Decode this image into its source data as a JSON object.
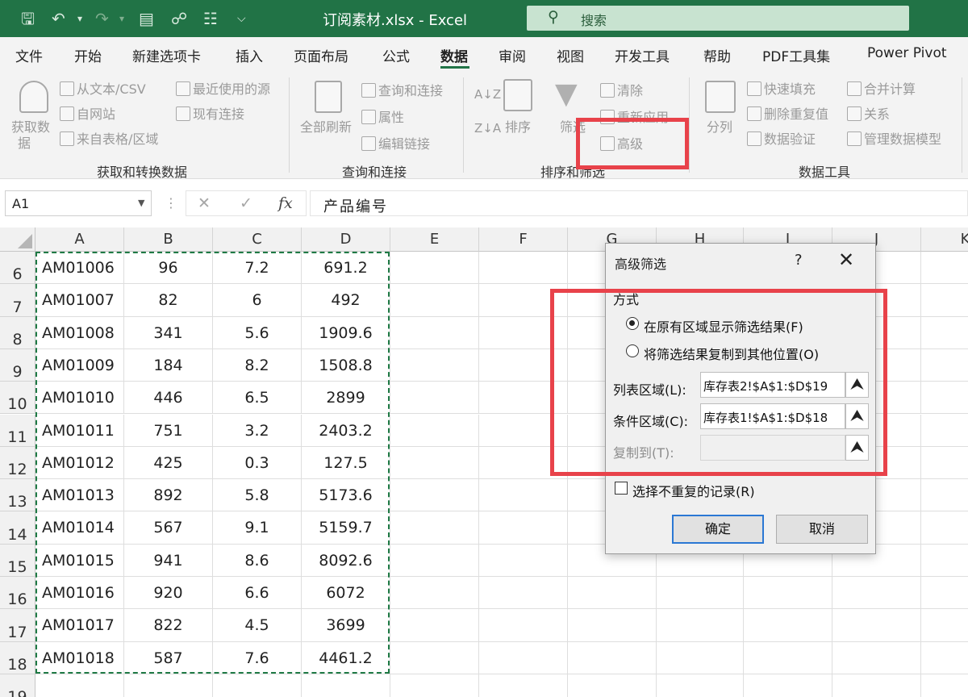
{
  "app": {
    "title": "订阅素材.xlsx  -  Excel",
    "search_placeholder": "搜索"
  },
  "quick_access": [
    "save-icon",
    "undo-icon",
    "redo-icon",
    "form-icon",
    "touch-icon",
    "print-preview-icon",
    "customize-icon"
  ],
  "tabs": [
    "文件",
    "开始",
    "新建选项卡",
    "插入",
    "页面布局",
    "公式",
    "数据",
    "审阅",
    "视图",
    "开发工具",
    "帮助",
    "PDF工具集",
    "Power Pivot"
  ],
  "active_tab": "数据",
  "ribbon": {
    "get_data": {
      "label_line1": "获取数",
      "label_line2": "据",
      "from_text": "从文本/CSV",
      "from_web": "自网站",
      "from_table": "来自表格/区域",
      "recent": "最近使用的源",
      "existing": "现有连接",
      "group": "获取和转换数据"
    },
    "queries": {
      "refresh_all": "全部刷新",
      "queries_conn": "查询和连接",
      "properties": "属性",
      "edit_links": "编辑链接",
      "group": "查询和连接"
    },
    "sort_filter": {
      "sort": "排序",
      "filter": "筛选",
      "clear": "清除",
      "reapply": "重新应用",
      "advanced": "高级",
      "group": "排序和筛选"
    },
    "data_tools": {
      "split": "分列",
      "flash_fill": "快速填充",
      "remove_dup": "删除重复值",
      "validation": "数据验证",
      "consolidate": "合并计算",
      "relations": "关系",
      "data_model": "管理数据模型",
      "group": "数据工具"
    },
    "highlight_color": "#e8424a"
  },
  "formula_bar": {
    "name_box": "A1",
    "cancel": "✕",
    "confirm": "✓",
    "fx": "fx",
    "formula": "产品编号"
  },
  "sheet": {
    "columns": [
      "A",
      "B",
      "C",
      "D",
      "E",
      "F",
      "G",
      "H",
      "I",
      "J",
      "K"
    ],
    "rows": [
      {
        "num": "6",
        "cells": [
          "AM01006",
          "96",
          "7.2",
          "691.2"
        ]
      },
      {
        "num": "7",
        "cells": [
          "AM01007",
          "82",
          "6",
          "492"
        ]
      },
      {
        "num": "8",
        "cells": [
          "AM01008",
          "341",
          "5.6",
          "1909.6"
        ]
      },
      {
        "num": "9",
        "cells": [
          "AM01009",
          "184",
          "8.2",
          "1508.8"
        ]
      },
      {
        "num": "10",
        "cells": [
          "AM01010",
          "446",
          "6.5",
          "2899"
        ]
      },
      {
        "num": "11",
        "cells": [
          "AM01011",
          "751",
          "3.2",
          "2403.2"
        ]
      },
      {
        "num": "12",
        "cells": [
          "AM01012",
          "425",
          "0.3",
          "127.5"
        ]
      },
      {
        "num": "13",
        "cells": [
          "AM01013",
          "892",
          "5.8",
          "5173.6"
        ]
      },
      {
        "num": "14",
        "cells": [
          "AM01014",
          "567",
          "9.1",
          "5159.7"
        ]
      },
      {
        "num": "15",
        "cells": [
          "AM01015",
          "941",
          "8.6",
          "8092.6"
        ]
      },
      {
        "num": "16",
        "cells": [
          "AM01016",
          "920",
          "6.6",
          "6072"
        ]
      },
      {
        "num": "17",
        "cells": [
          "AM01017",
          "822",
          "4.5",
          "3699"
        ]
      },
      {
        "num": "18",
        "cells": [
          "AM01018",
          "587",
          "7.6",
          "4461.2"
        ]
      },
      {
        "num": "19",
        "cells": [
          "",
          "",
          "",
          ""
        ]
      }
    ]
  },
  "dialog": {
    "title": "高级筛选",
    "help": "?",
    "close": "✕",
    "mode_label": "方式",
    "option_inplace": "在原有区域显示筛选结果(F)",
    "option_copy": "将筛选结果复制到其他位置(O)",
    "list_range_label": "列表区域(L):",
    "list_range_value": "库存表2!$A$1:$D$19",
    "criteria_label": "条件区域(C):",
    "criteria_value": "库存表1!$A$1:$D$18",
    "copy_to_label": "复制到(T):",
    "copy_to_value": "",
    "unique_label": "选择不重复的记录(R)",
    "ok": "确定",
    "cancel": "取消",
    "selected_option": "inplace",
    "unique_checked": false
  }
}
